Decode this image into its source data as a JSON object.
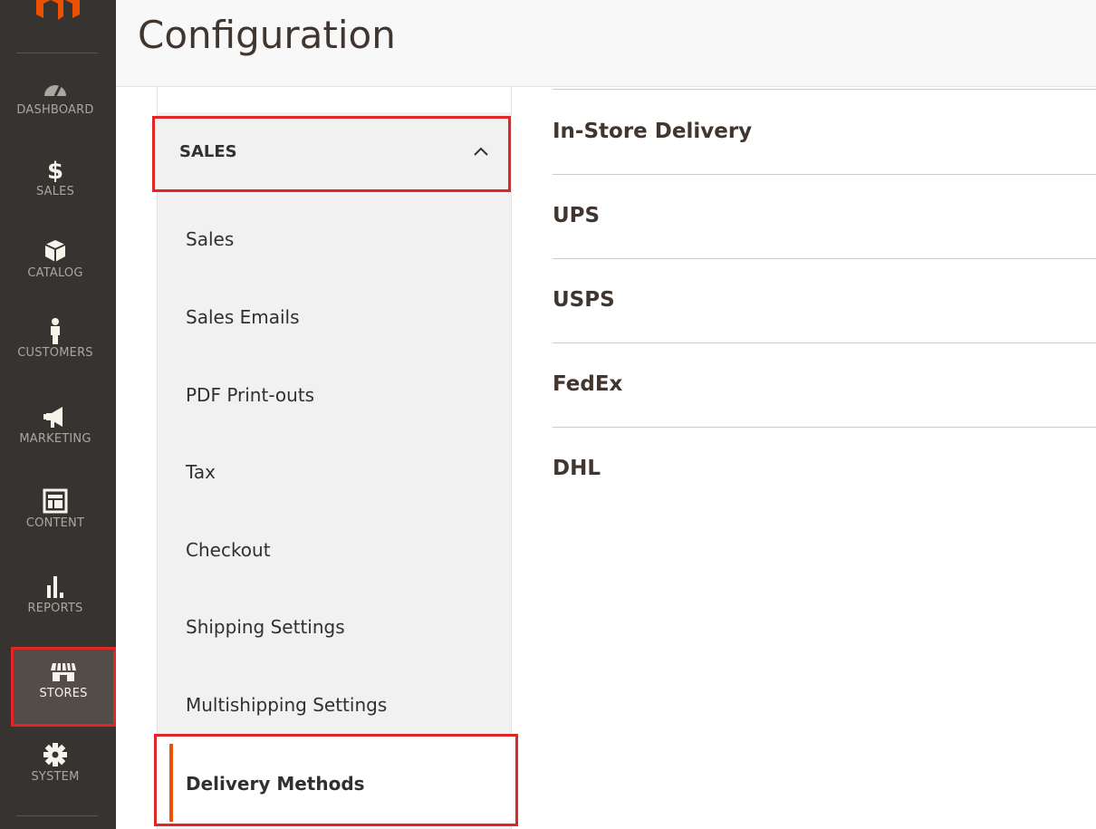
{
  "nav": {
    "items": [
      {
        "label": "DASHBOARD",
        "icon": "dashboard-icon"
      },
      {
        "label": "SALES",
        "icon": "dollar-icon"
      },
      {
        "label": "CATALOG",
        "icon": "box-icon"
      },
      {
        "label": "CUSTOMERS",
        "icon": "person-icon"
      },
      {
        "label": "MARKETING",
        "icon": "megaphone-icon"
      },
      {
        "label": "CONTENT",
        "icon": "layout-icon"
      },
      {
        "label": "REPORTS",
        "icon": "bar-chart-icon"
      },
      {
        "label": "STORES",
        "icon": "storefront-icon"
      },
      {
        "label": "SYSTEM",
        "icon": "gear-icon"
      }
    ],
    "active": "STORES"
  },
  "header": {
    "title": "Configuration"
  },
  "config_tabs": {
    "group_title": "SALES",
    "items": [
      "Sales",
      "Sales Emails",
      "PDF Print-outs",
      "Tax",
      "Checkout",
      "Shipping Settings",
      "Multishipping Settings"
    ],
    "active_item": "Delivery Methods"
  },
  "sections": [
    "In-Store Delivery",
    "UPS",
    "USPS",
    "FedEx",
    "DHL"
  ],
  "colors": {
    "nav_bg": "#373330",
    "accent": "#eb5202",
    "highlight": "#e22626"
  }
}
